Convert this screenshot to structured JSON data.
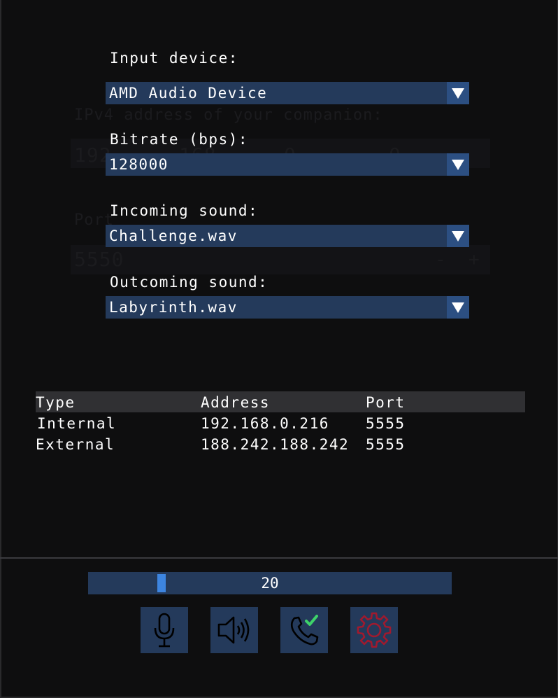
{
  "ghost_background": {
    "address_label": "IPv4 address of your companion:",
    "octets": [
      "192",
      "168",
      "0",
      "0"
    ],
    "port_label": "Port",
    "port_value": "5550",
    "minus": "-",
    "plus": "+"
  },
  "settings": {
    "input_device": {
      "label": "Input device:",
      "value": "AMD Audio Device"
    },
    "bitrate": {
      "label": "Bitrate (bps):",
      "value": "128000"
    },
    "incoming_sound": {
      "label": "Incoming sound:",
      "value": "Challenge.wav"
    },
    "outcoming_sound": {
      "label": "Outcoming sound:",
      "value": "Labyrinth.wav"
    }
  },
  "address_table": {
    "headers": [
      "Type",
      "Address",
      "Port"
    ],
    "rows": [
      [
        "Internal",
        "192.168.0.216",
        "5555"
      ],
      [
        "External",
        "188.242.188.242",
        "5555"
      ]
    ]
  },
  "volume": {
    "value": "20"
  },
  "toolbar": {
    "buttons": [
      {
        "icon": "microphone-icon"
      },
      {
        "icon": "speaker-icon"
      },
      {
        "icon": "phone-accepted-icon"
      },
      {
        "icon": "gear-icon"
      }
    ]
  },
  "colors": {
    "background": "#0e0e0f",
    "widget": "#243a5b",
    "widget_arrow": "#2c4f82",
    "slider_grab": "#3d85e0",
    "table_header": "#303033",
    "check_green": "#3ed36a",
    "gear_red": "#a01a2e"
  }
}
